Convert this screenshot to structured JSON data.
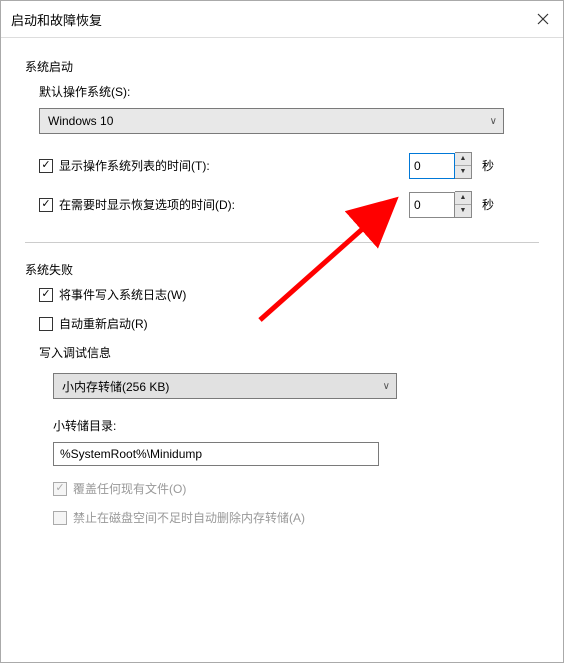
{
  "titlebar": {
    "title": "启动和故障恢复"
  },
  "startup": {
    "group_label": "系统启动",
    "default_os_label": "默认操作系统(S):",
    "default_os_value": "Windows 10",
    "show_os_list_label": "显示操作系统列表的时间(T):",
    "show_os_list_value": "0",
    "show_recovery_label": "在需要时显示恢复选项的时间(D):",
    "show_recovery_value": "0",
    "seconds_unit": "秒"
  },
  "failure": {
    "group_label": "系统失败",
    "write_event_label": "将事件写入系统日志(W)",
    "auto_restart_label": "自动重新启动(R)",
    "debug_group_label": "写入调试信息",
    "dump_type_value": "小内存转储(256 KB)",
    "dump_dir_label": "小转储目录:",
    "dump_dir_value": "%SystemRoot%\\Minidump",
    "overwrite_label": "覆盖任何现有文件(O)",
    "disable_auto_delete_label": "禁止在磁盘空间不足时自动删除内存转储(A)"
  }
}
